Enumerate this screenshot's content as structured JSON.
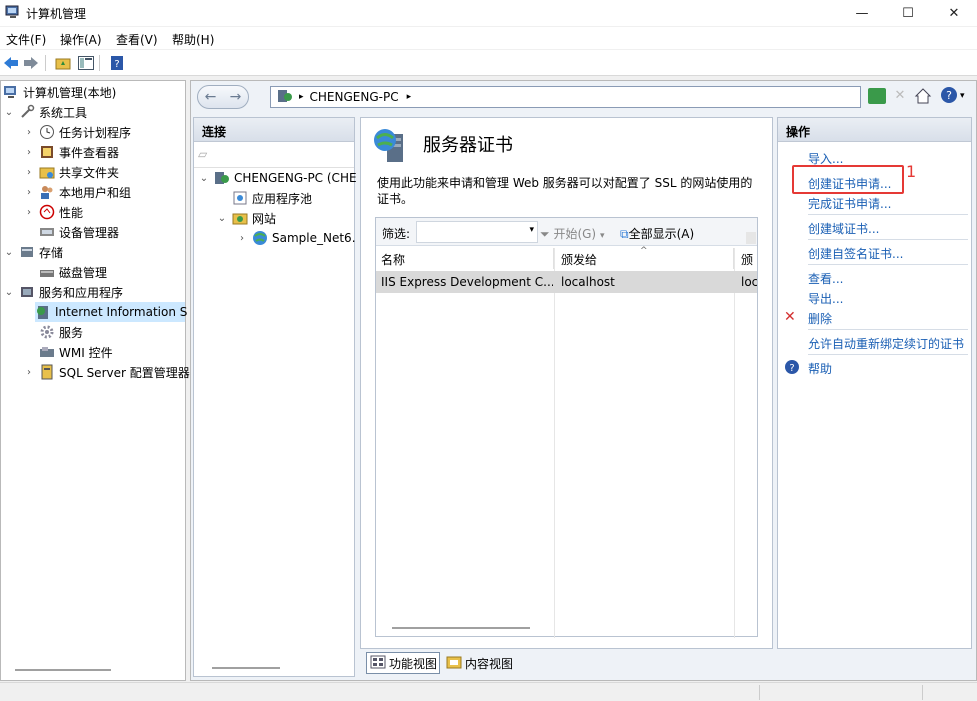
{
  "window": {
    "title": "计算机管理",
    "controls": [
      "—",
      "☐",
      "✕"
    ]
  },
  "menu": [
    "文件(F)",
    "操作(A)",
    "查看(V)",
    "帮助(H)"
  ],
  "tree": {
    "root": "计算机管理(本地)",
    "items": [
      {
        "label": "系统工具",
        "level": 0,
        "expanded": true
      },
      {
        "label": "任务计划程序",
        "level": 1
      },
      {
        "label": "事件查看器",
        "level": 1
      },
      {
        "label": "共享文件夹",
        "level": 1
      },
      {
        "label": "本地用户和组",
        "level": 1
      },
      {
        "label": "性能",
        "level": 1
      },
      {
        "label": "设备管理器",
        "level": 1
      },
      {
        "label": "存储",
        "level": 0,
        "expanded": true
      },
      {
        "label": "磁盘管理",
        "level": 1
      },
      {
        "label": "服务和应用程序",
        "level": 0,
        "expanded": true
      },
      {
        "label": "Internet Information S",
        "level": 1,
        "selected": true
      },
      {
        "label": "服务",
        "level": 1
      },
      {
        "label": "WMI 控件",
        "level": 1
      },
      {
        "label": "SQL Server 配置管理器",
        "level": 1
      }
    ]
  },
  "address": {
    "path": "CHENGENG-PC",
    "sep": "▸"
  },
  "connections": {
    "header": "连接",
    "server": "CHENGENG-PC (CHE",
    "app_pools": "应用程序池",
    "sites": "网站",
    "site1": "Sample_Net6."
  },
  "feature": {
    "title": "服务器证书",
    "description": "使用此功能来申请和管理 Web 服务器可以对配置了 SSL 的网站使用的证书。",
    "filter_label": "筛选:",
    "start_btn": "开始(G)",
    "show_all_btn": "全部显示(A)",
    "columns": [
      "名称",
      "颁发给",
      "颁发"
    ],
    "rows": [
      {
        "name": "IIS Express Development C...",
        "issued_to": "localhost",
        "issued_by": "loc"
      }
    ],
    "tabs": [
      "功能视图",
      "内容视图"
    ]
  },
  "actions": {
    "header": "操作",
    "items": [
      "导入...",
      "创建证书申请...",
      "完成证书申请...",
      "创建域证书...",
      "创建自签名证书...",
      "查看...",
      "导出...",
      "删除",
      "允许自动重新绑定续订的证书",
      "帮助"
    ],
    "annotation": "1"
  },
  "colors": {
    "link": "#1a5fb4",
    "annotation_red": "#e53935",
    "selection": "#cce8ff"
  }
}
